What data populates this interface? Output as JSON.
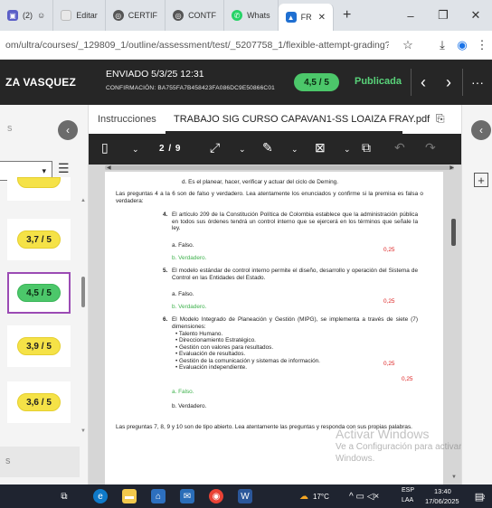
{
  "browser": {
    "tabs": [
      {
        "label": "(2)",
        "icon": "teams-icon"
      },
      {
        "label": "Editar",
        "icon": "page-icon"
      },
      {
        "label": "CERTIF",
        "icon": "globe-icon"
      },
      {
        "label": "CONTF",
        "icon": "globe-icon"
      },
      {
        "label": "Whats",
        "icon": "whatsapp-icon"
      },
      {
        "label": "FR",
        "icon": "blackboard-icon"
      }
    ],
    "new_tab": "+",
    "url": "om/ultra/courses/_129809_1/outline/assessment/test/_5207758_1/flexible-attempt-grading?c...",
    "window_controls": [
      "–",
      "❐",
      "✕"
    ]
  },
  "header": {
    "student_name": "ZA VASQUEZ",
    "sent": "ENVIADO 5/3/25 12:31",
    "confirmation": "CONFIRMACIÓN: BA755FA7B458423FA086DC9E50866C01",
    "score": "4,5 / 5",
    "status": "Publicada"
  },
  "left_panel": {
    "tab_fragment": "s",
    "items": [
      {
        "score": "",
        "selected": false
      },
      {
        "score": "3,7 / 5",
        "selected": false
      },
      {
        "score": "4,5 / 5",
        "selected": true
      },
      {
        "score": "3,9 / 5",
        "selected": false
      },
      {
        "score": "3,6 / 5",
        "selected": false
      }
    ],
    "bottom_fragment": "s"
  },
  "viewer": {
    "tabs": [
      "Instrucciones",
      "TRABAJO SIG CURSO CAPAVAN1-SS LOAIZA FRAY.pdf"
    ],
    "page_indicator": "2 / 9"
  },
  "pdf": {
    "d_option": "d.  Es el planear, hacer, verificar y actuar del ciclo de Deming.",
    "intro_4_6": "Las preguntas 4 a la 6 son de falso y verdadero. Lea atentamente los enunciados y confirme si la premisa es falsa o verdadera:",
    "q4_num": "4.",
    "q4": "El artículo 209 de la Constitución Política de Colombia establece que la administración pública en todos sus órdenes tendrá un control interno que se ejercerá en los términos que señale la ley.",
    "q4_a": "a.  Falso.",
    "q4_b": "b.  Verdadero.",
    "q4_pts": "0,25",
    "q5_num": "5.",
    "q5": "El modelo estándar de control interno permite el diseño, desarrollo y operación del Sistema de Control en las Entidades del Estado.",
    "q5_a": "a.  Falso.",
    "q5_b": "b.  Verdadero.",
    "q5_pts": "0,25",
    "q6_num": "6.",
    "q6": "El Modelo Integrado de Planeación y Gestión (MIPG), se implementa a través de siete (7) dimensiones:",
    "q6_bullets": [
      "•   Talento Humano.",
      "•   Direccionamiento Estratégico.",
      "•   Gestión con valores para resultados.",
      "•   Evaluación de resultados.",
      "•   Gestión de la comunicación y sistemas de información.",
      "•   Evaluación independiente."
    ],
    "q6_pts_1": "0,25",
    "q6_pts_2": "0,25",
    "q6_a": "a.  Falso.",
    "q6_b": "b.  Verdadero.",
    "intro_7_10": "Las preguntas 7, 8, 9 y 10 son de tipo abierto. Lea atentamente las preguntas y responda con sus propias palabras."
  },
  "watermark": {
    "line1": "Activar Windows",
    "line2": "Ve a Configuración para activar Windows."
  },
  "taskbar": {
    "weather": "17°C",
    "lang_1": "ESP",
    "lang_2": "LAA",
    "time": "13:40",
    "date": "17/06/2025",
    "notification_count": "2"
  },
  "colors": {
    "header_bg": "#262626",
    "score_green": "#4cc76a",
    "score_yellow": "#f5e247",
    "selected_border": "#9b4bb4",
    "points_red": "#dd2222",
    "answer_green": "#3fb24d"
  }
}
